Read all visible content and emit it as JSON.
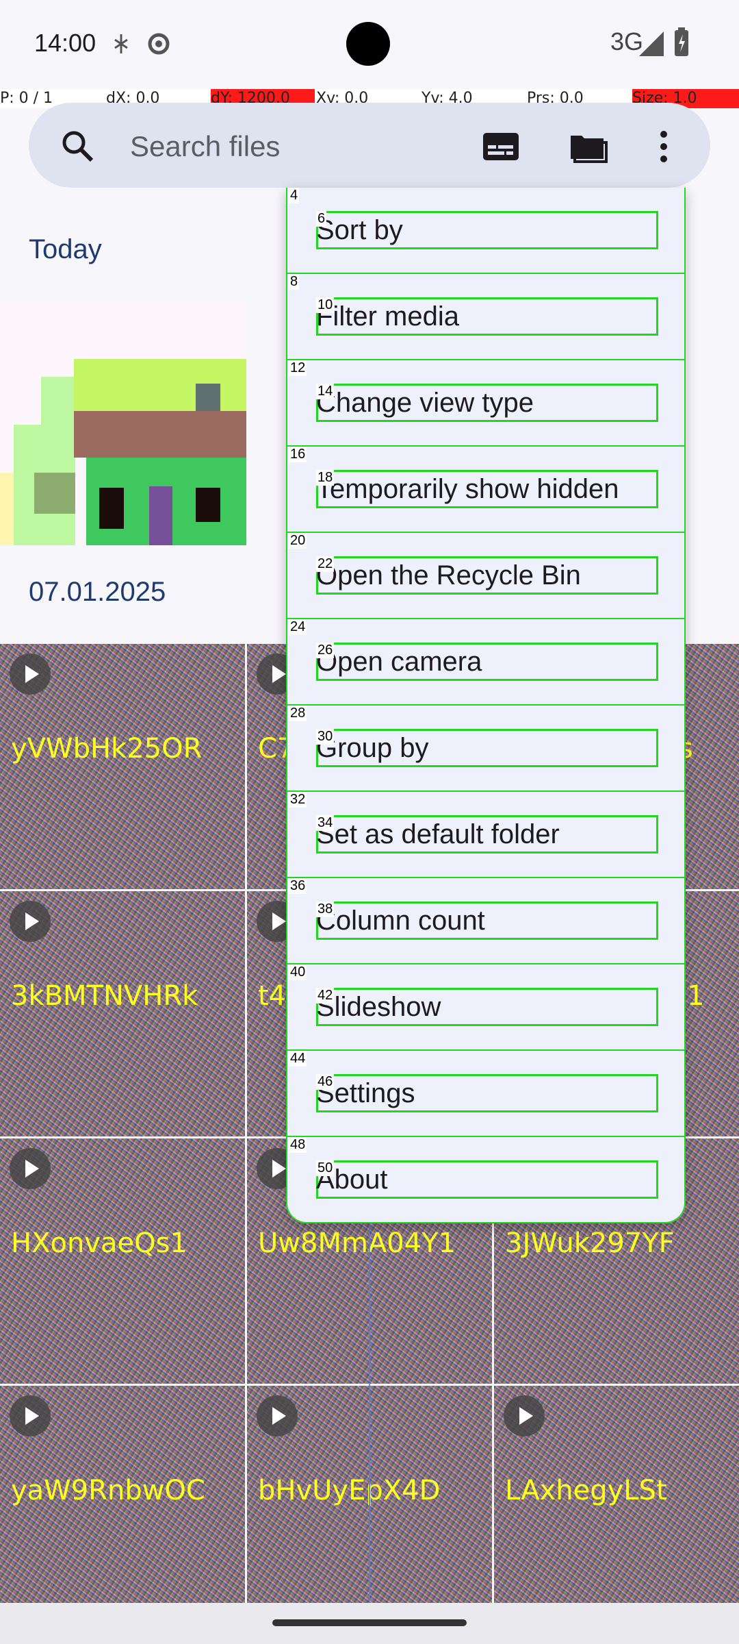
{
  "status": {
    "time": "14:00",
    "network": "3G"
  },
  "pointer": {
    "p": "P: 0 / 1",
    "dx": "dX: 0.0",
    "dy": "dY: 1200.0",
    "xv": "Xv: 0.0",
    "yv": "Yv: 4.0",
    "prs": "Prs: 0.0",
    "size": "Size: 1.0"
  },
  "search": {
    "placeholder": "Search files"
  },
  "sections": {
    "today": "Today",
    "date": "07.01.2025"
  },
  "grid": {
    "labels": [
      "yVWbHk25OR",
      "C7",
      "s",
      "3kBMTNVHRk",
      "t4",
      "1",
      "HXonvaeQs1",
      "Uw8MmA04Y1",
      "3JWuk297YF",
      "yaW9RnbwOC",
      "bHvUyEpX4D",
      "LAxhegyLSt"
    ]
  },
  "menu": {
    "items": [
      {
        "label": "Sort by",
        "idx": "4",
        "idx2": "6"
      },
      {
        "label": "Filter media",
        "idx": "8",
        "idx2": "10"
      },
      {
        "label": "Change view type",
        "idx": "12",
        "idx2": "14"
      },
      {
        "label": "Temporarily show hidden",
        "idx": "16",
        "idx2": "18"
      },
      {
        "label": "Open the Recycle Bin",
        "idx": "20",
        "idx2": "22"
      },
      {
        "label": "Open camera",
        "idx": "24",
        "idx2": "26"
      },
      {
        "label": "Group by",
        "idx": "28",
        "idx2": "30"
      },
      {
        "label": "Set as default folder",
        "idx": "32",
        "idx2": "34"
      },
      {
        "label": "Column count",
        "idx": "36",
        "idx2": "38"
      },
      {
        "label": "Slideshow",
        "idx": "40",
        "idx2": "42"
      },
      {
        "label": "Settings",
        "idx": "44",
        "idx2": "46"
      },
      {
        "label": "About",
        "idx": "48",
        "idx2": "50"
      }
    ]
  },
  "colors": {
    "accent": "#1e3b70",
    "highlight": "#22d622",
    "label": "#ffff22"
  }
}
